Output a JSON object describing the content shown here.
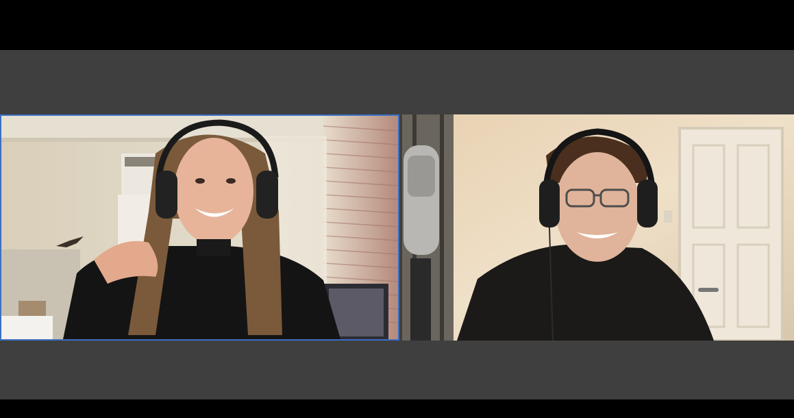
{
  "window": {
    "background_color": "#000000",
    "gallery_background_color": "#3f3f3f"
  },
  "gallery": {
    "layout": "side-by-side",
    "active_speaker_border_color": "#3a6fc4",
    "participants": [
      {
        "tile": "participant-video-1",
        "active_speaker": true,
        "headphones": true
      },
      {
        "tile": "participant-video-2",
        "active_speaker": false,
        "headphones": true
      }
    ]
  }
}
